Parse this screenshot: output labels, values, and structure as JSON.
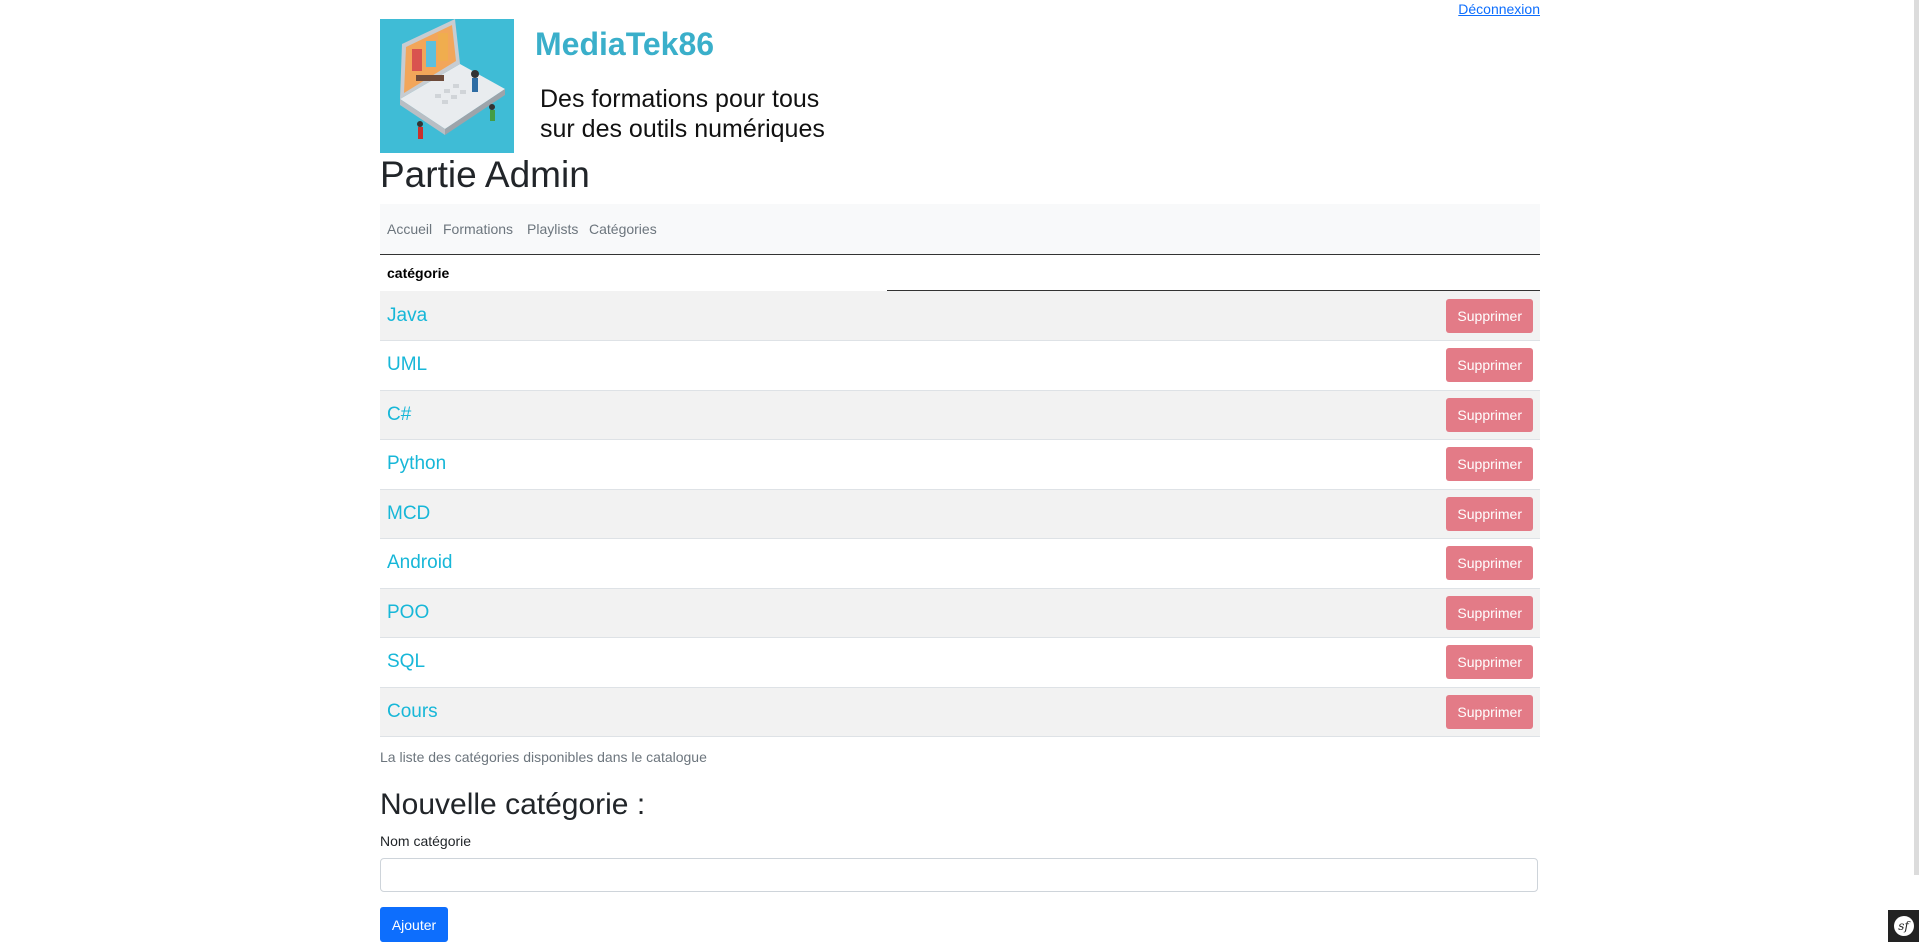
{
  "header": {
    "logout_label": "Déconnexion",
    "brand": "MediaTek86",
    "tagline_line1": "Des formations pour tous",
    "tagline_line2": "sur des outils numériques",
    "logo_icon": "laptop-illustration-icon"
  },
  "admin_title": "Partie Admin",
  "nav": {
    "items": [
      {
        "label": "Accueil"
      },
      {
        "label": "Formations"
      },
      {
        "label": "Playlists"
      },
      {
        "label": "Catégories"
      }
    ]
  },
  "table": {
    "header": "catégorie",
    "delete_label": "Supprimer",
    "rows": [
      {
        "name": "Java"
      },
      {
        "name": "UML"
      },
      {
        "name": "C#"
      },
      {
        "name": "Python"
      },
      {
        "name": "MCD"
      },
      {
        "name": "Android"
      },
      {
        "name": "POO"
      },
      {
        "name": "SQL"
      },
      {
        "name": "Cours"
      }
    ],
    "caption": "La liste des catégories disponibles dans le catalogue"
  },
  "form": {
    "title": "Nouvelle catégorie :",
    "label": "Nom catégorie",
    "value": "",
    "submit_label": "Ajouter"
  },
  "colors": {
    "brand": "#3aafca",
    "link": "#17b7d8",
    "danger": "#e37b87",
    "primary": "#0d6efd"
  },
  "toolbar_icon": "symfony-icon"
}
